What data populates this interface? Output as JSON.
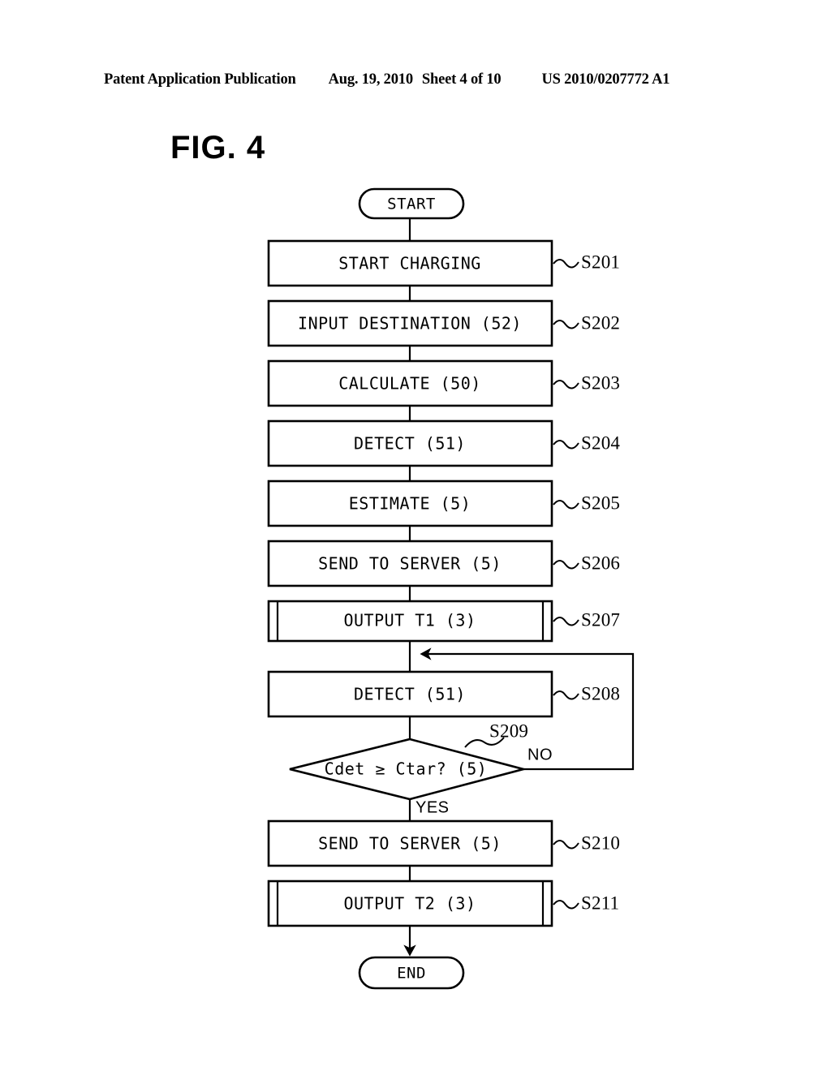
{
  "header": {
    "publication": "Patent Application Publication",
    "date": "Aug. 19, 2010",
    "sheet": "Sheet 4 of 10",
    "patent_number": "US 2010/0207772 A1"
  },
  "figure": {
    "title": "FIG. 4"
  },
  "flowchart": {
    "start_label": "START",
    "end_label": "END",
    "yes_label": "YES",
    "no_label": "NO",
    "decision": {
      "text": "Cdet ≥ Ctar?  (5)",
      "step": "S209"
    },
    "steps": [
      {
        "text": "START CHARGING",
        "step": "S201",
        "shape": "process"
      },
      {
        "text": "INPUT DESTINATION (52)",
        "step": "S202",
        "shape": "process"
      },
      {
        "text": "CALCULATE (50)",
        "step": "S203",
        "shape": "process"
      },
      {
        "text": "DETECT (51)",
        "step": "S204",
        "shape": "process"
      },
      {
        "text": "ESTIMATE (5)",
        "step": "S205",
        "shape": "process"
      },
      {
        "text": "SEND TO SERVER (5)",
        "step": "S206",
        "shape": "process"
      },
      {
        "text": "OUTPUT T1 (3)",
        "step": "S207",
        "shape": "predefined"
      },
      {
        "text": "DETECT (51)",
        "step": "S208",
        "shape": "process"
      },
      {
        "text": "SEND TO SERVER (5)",
        "step": "S210",
        "shape": "process"
      },
      {
        "text": "OUTPUT T2 (3)",
        "step": "S211",
        "shape": "predefined"
      }
    ]
  },
  "colors": {
    "ink": "#000000",
    "paper": "#ffffff"
  }
}
